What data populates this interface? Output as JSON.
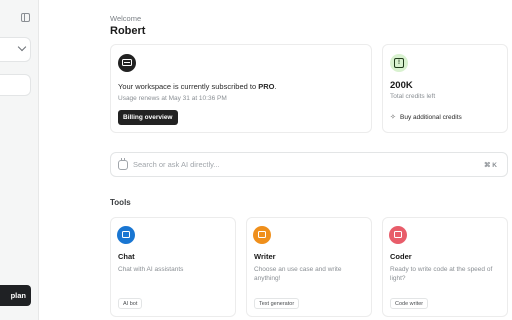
{
  "sidebar": {
    "upgrade_label": "plan"
  },
  "header": {
    "welcome": "Welcome",
    "user_name": "Robert"
  },
  "subscription": {
    "text_prefix": "Your workspace is currently subscribed to ",
    "plan": "PRO",
    "text_suffix": ".",
    "renewal": "Usage renews at May 31 at 10:36 PM",
    "billing_button": "Billing overview"
  },
  "credits": {
    "amount": "200K",
    "caption": "Total credits left",
    "buy_button": "Buy additional credits"
  },
  "search": {
    "placeholder": "Search or ask AI directly...",
    "shortcut": "⌘ K"
  },
  "tools": {
    "title": "Tools",
    "items": [
      {
        "name": "Chat",
        "description": "Chat with AI assistants",
        "tag": "AI bot",
        "icon": "chat-icon",
        "color": "#1976d2"
      },
      {
        "name": "Writer",
        "description": "Choose an use case and write anything!",
        "tag": "Text generator",
        "icon": "document-icon",
        "color": "#ef8f1c"
      },
      {
        "name": "Coder",
        "description": "Ready to write code at the speed of light?",
        "tag": "Code writer",
        "icon": "monitor-icon",
        "color": "#e85d6a"
      }
    ]
  }
}
